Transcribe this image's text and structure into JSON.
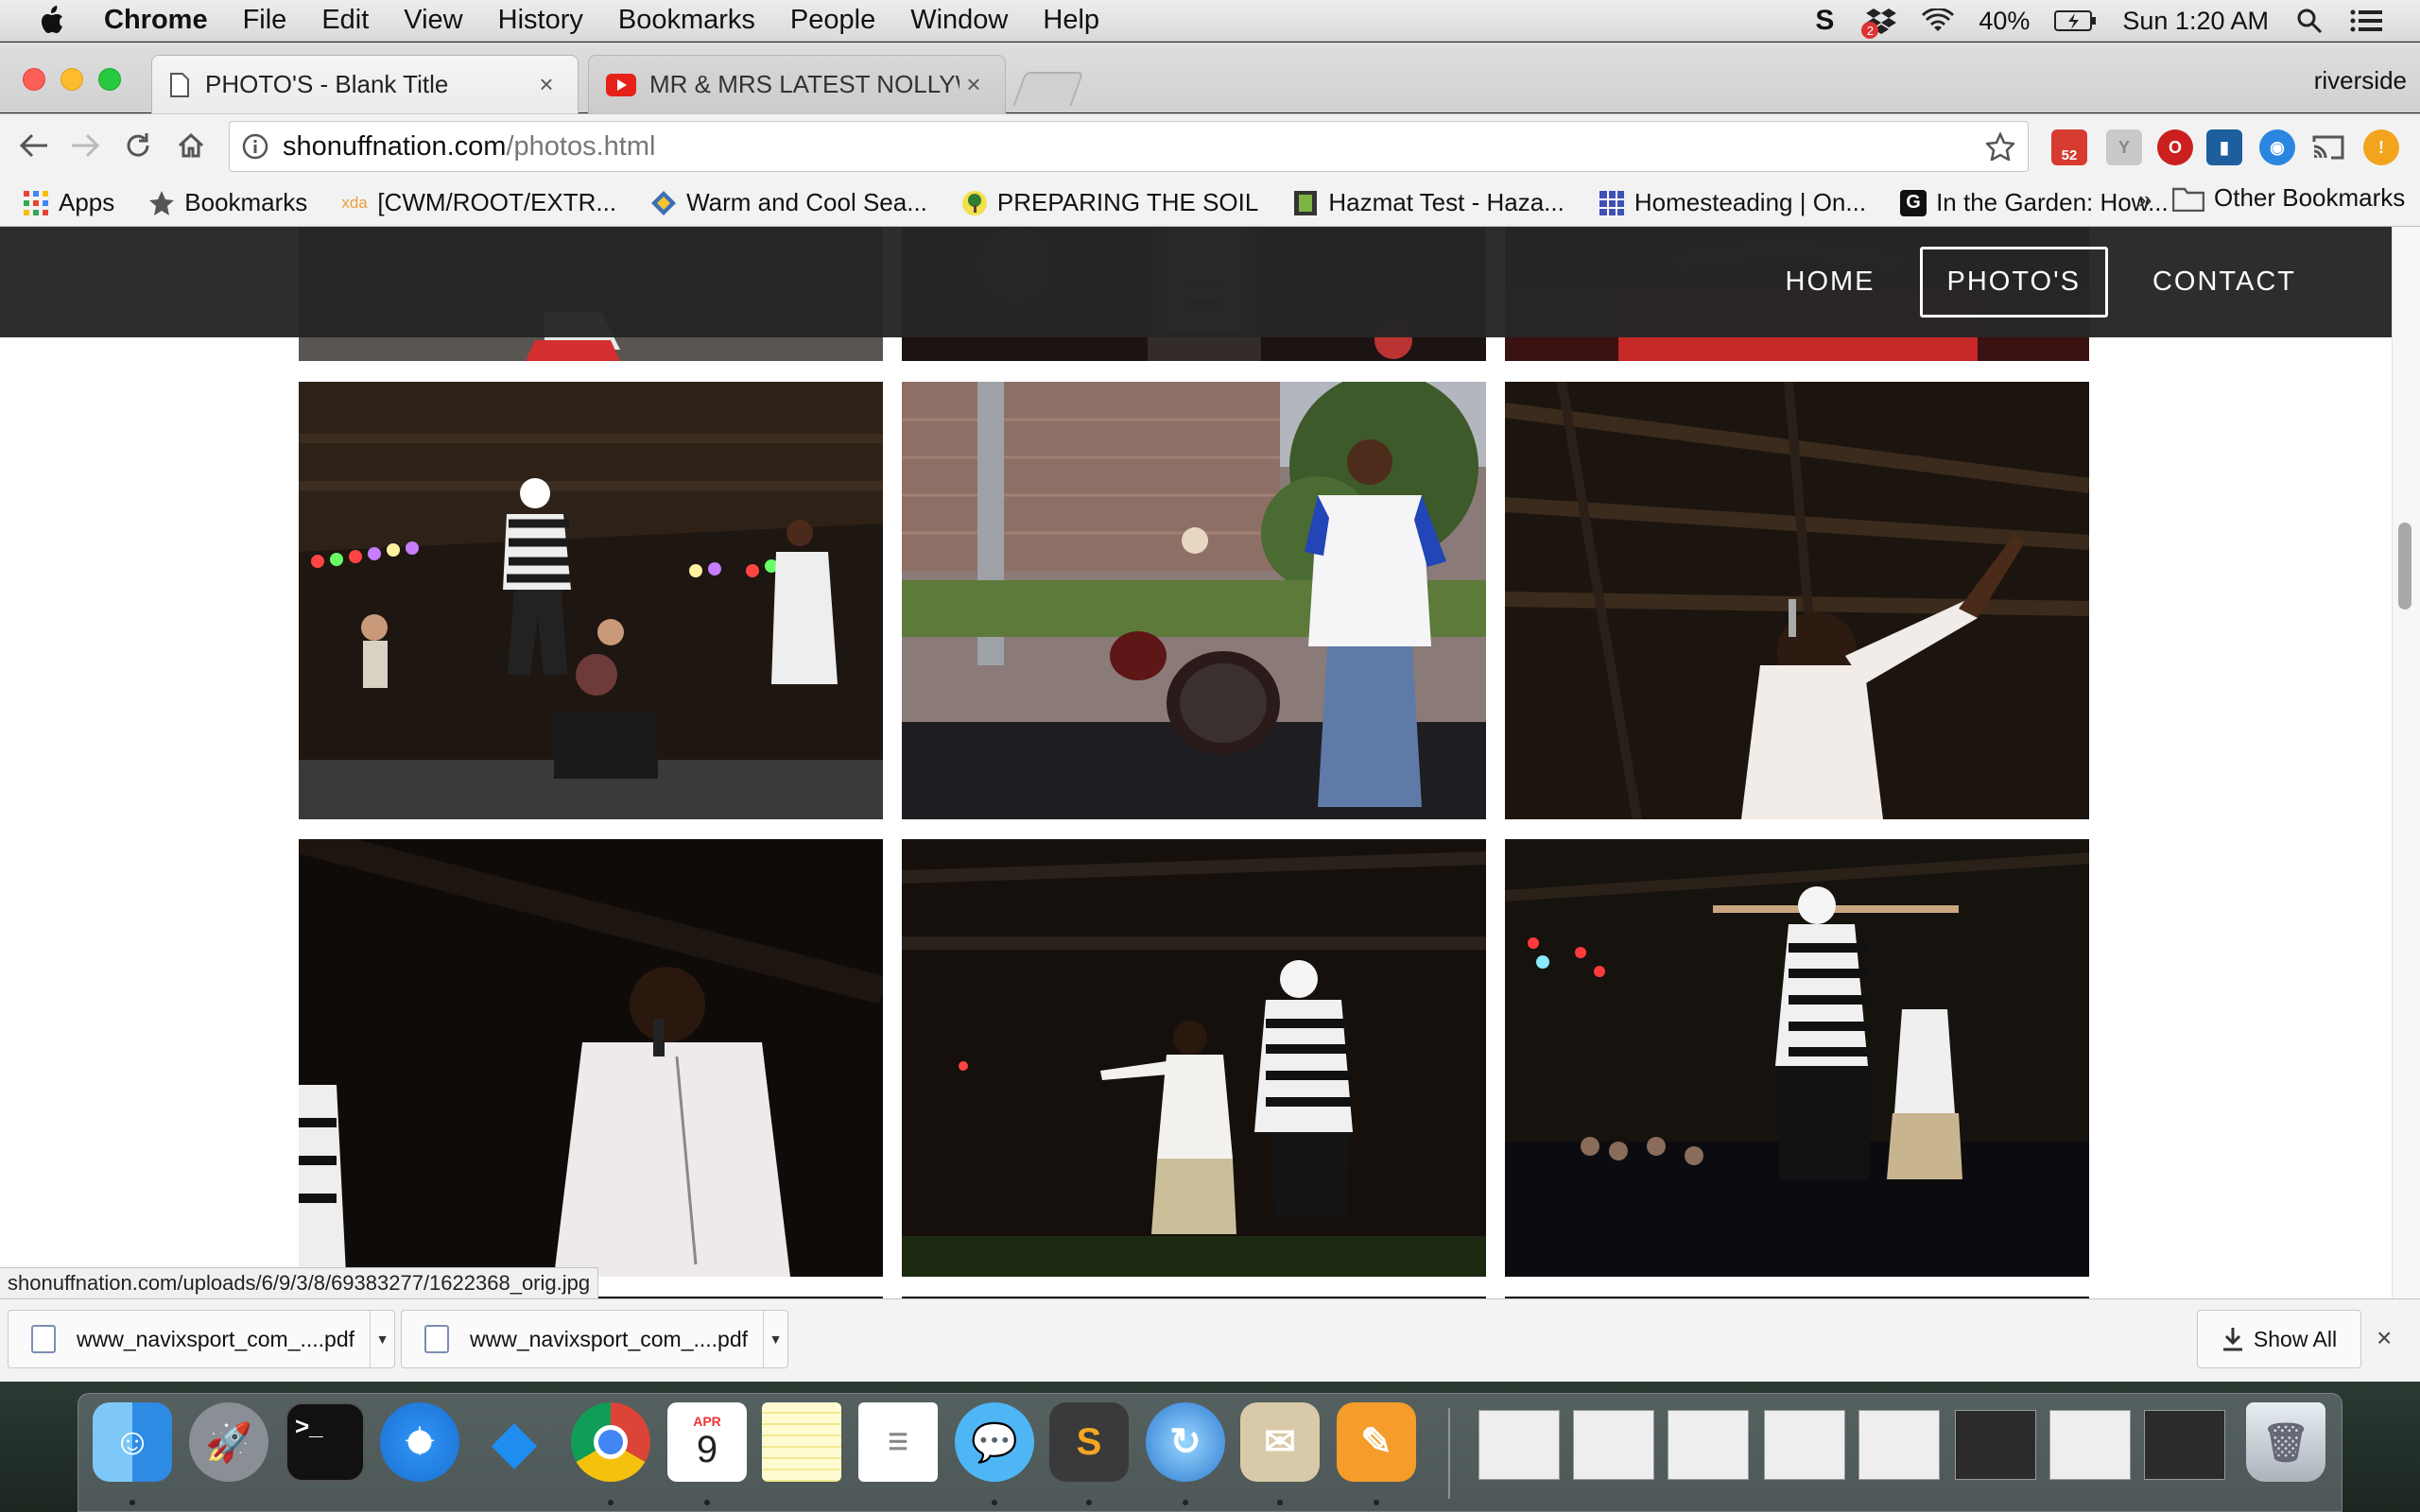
{
  "menubar": {
    "app": "Chrome",
    "items": [
      "File",
      "Edit",
      "View",
      "History",
      "Bookmarks",
      "People",
      "Window",
      "Help"
    ],
    "battery": "40%",
    "clock": "Sun 1:20 AM",
    "notification_badge": "2"
  },
  "browser": {
    "tabs": [
      {
        "label": "PHOTO'S - Blank Title",
        "active": true
      },
      {
        "label": "MR & MRS LATEST NOLLYWOOD",
        "active": false
      }
    ],
    "profile": "riverside",
    "url_host": "shonuffnation.com",
    "url_path": "/photos.html",
    "extension_badge": "52",
    "bookmarks": [
      {
        "label": "Apps",
        "icon": "apps-grid-icon"
      },
      {
        "label": "Bookmarks",
        "icon": "star-icon"
      },
      {
        "label": "[CWM/ROOT/EXTR...",
        "icon": "xda-icon"
      },
      {
        "label": "Warm and Cool Sea...",
        "icon": "diamond-icon"
      },
      {
        "label": "PREPARING THE SOIL",
        "icon": "tree-icon"
      },
      {
        "label": "Hazmat Test - Haza...",
        "icon": "film-icon"
      },
      {
        "label": "Homesteading | On...",
        "icon": "grid-icon"
      },
      {
        "label": "In the Garden: How...",
        "icon": "g-icon"
      }
    ],
    "bookmarks_more": "»",
    "other_bookmarks": "Other Bookmarks"
  },
  "site": {
    "nav": [
      {
        "label": "HOME",
        "active": false
      },
      {
        "label": "PHOTO'S",
        "active": true
      },
      {
        "label": "CONTACT",
        "active": false
      }
    ]
  },
  "status_url": "shonuffnation.com/uploads/6/9/3/8/69383277/1622368_orig.jpg",
  "downloads": {
    "items": [
      "www_navixsport_com_....pdf",
      "www_navixsport_com_....pdf"
    ],
    "show_all": "Show All"
  },
  "dock": {
    "calendar_month": "APR",
    "calendar_day": "9"
  }
}
